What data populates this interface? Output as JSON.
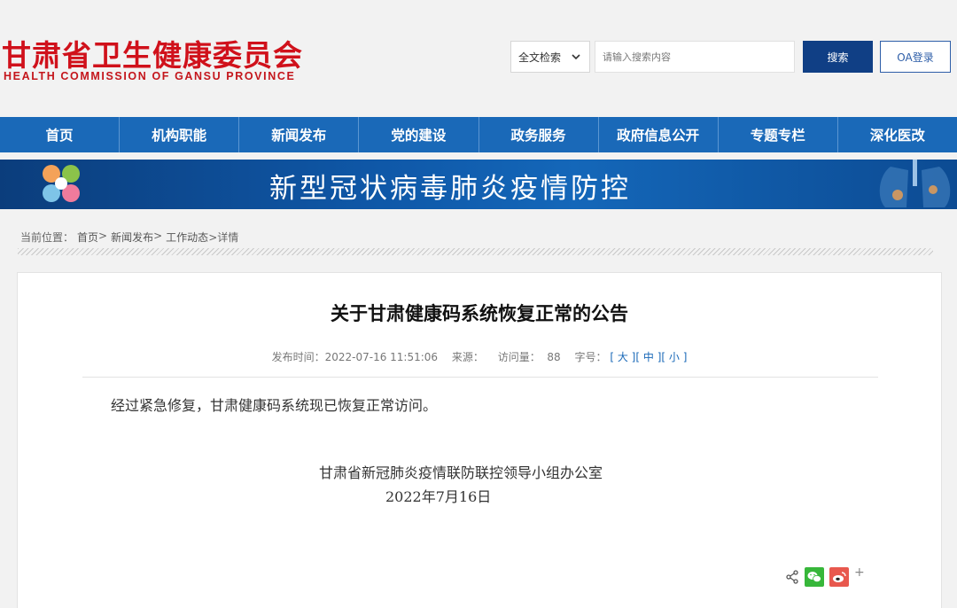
{
  "header": {
    "logo_cn": "甘肃省卫生健康委员会",
    "logo_en": "HEALTH  COMMISSION  OF  GANSU  PROVINCE",
    "search_scope": "全文检索",
    "search_placeholder": "请输入搜索内容",
    "search_button": "搜索",
    "oa_button": "OA登录"
  },
  "nav": {
    "items": [
      {
        "label": "首页"
      },
      {
        "label": "机构职能"
      },
      {
        "label": "新闻发布"
      },
      {
        "label": "党的建设"
      },
      {
        "label": "政务服务"
      },
      {
        "label": "政府信息公开"
      },
      {
        "label": "专题专栏"
      },
      {
        "label": "深化医改"
      }
    ]
  },
  "banner": {
    "title": "新型冠状病毒肺炎疫情防控"
  },
  "breadcrumb": {
    "prefix": "当前位置：",
    "items": [
      "首页",
      ">",
      "新闻发布",
      ">",
      "工作动态",
      ">详情"
    ]
  },
  "article": {
    "title": "关于甘肃健康码系统恢复正常的公告",
    "meta": {
      "publish_label": "发布时间：",
      "publish_time": "2022-07-16 11:51:06",
      "source_label": "来源：",
      "source": "",
      "views_label": "访问量：",
      "views": "88",
      "fontsize_label": "字号：",
      "font_large": "大",
      "font_medium": "中",
      "font_small": "小"
    },
    "body": "经过紧急修复，甘肃健康码系统现已恢复正常访问。",
    "signature_org": "甘肃省新冠肺炎疫情联防联控领导小组办公室",
    "signature_date": "2022年7月16日"
  },
  "share": {
    "icons": [
      "share-icon",
      "wechat-icon",
      "weibo-icon",
      "plus-icon"
    ],
    "plus": "+"
  },
  "colors": {
    "logo_red": "#d0111b",
    "nav_blue": "#1a69b8",
    "search_button_blue": "#103f85",
    "wechat_green": "#37b73a",
    "weibo_red": "#e8584e"
  }
}
